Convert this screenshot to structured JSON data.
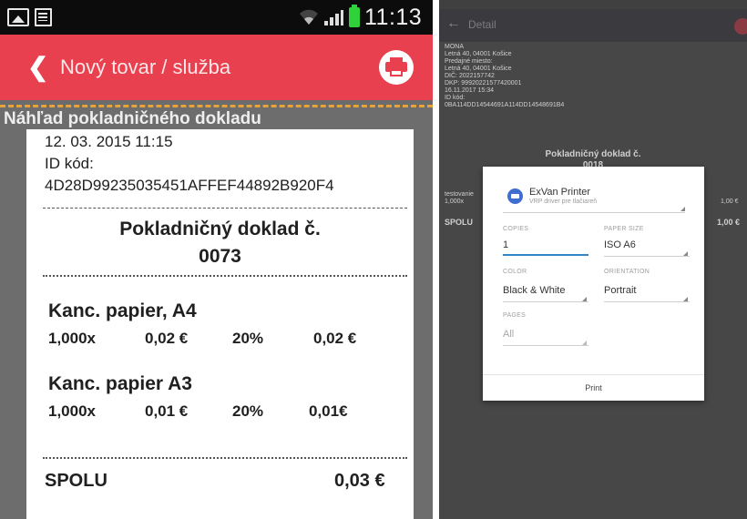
{
  "left": {
    "status": {
      "time": "11:13"
    },
    "appbar": {
      "back": "❮",
      "title": "Nový tovar / služba"
    },
    "preview_title": "Náhľad pokladničného dokladu",
    "receipt": {
      "datetime": "12. 03. 2015 11:15",
      "id_label": "ID kód:",
      "id_code": "4D28D99235035451AFFEF44892B920F4",
      "doc_line1": "Pokladničný doklad č.",
      "doc_line2": "0073",
      "items": [
        {
          "name": "Kanc. papier, A4",
          "qty": "1,000x",
          "price": "0,02 €",
          "vat": "20%",
          "total": "0,02 €"
        },
        {
          "name": "Kanc. papier A3",
          "qty": "1,000x",
          "price": "0,01 €",
          "vat": "20%",
          "total": "0,01€"
        }
      ],
      "total_label": "SPOLU",
      "total_value": "0,03 €"
    }
  },
  "right": {
    "appbar": {
      "back": "←",
      "title": "Detail"
    },
    "receipt_lines": [
      "MONA",
      "Letná 40, 04001 Košice",
      "Predajné miesto:",
      "Letná 40, 04001 Košice",
      "DIČ: 2022157742",
      "DKP: 99920221577420001",
      "16.11.2017 15:34",
      "ID kód:",
      "0BA114DD14544691A114DD14548691B4"
    ],
    "doc_line1": "Pokladničný doklad č.",
    "doc_line2": "0018",
    "item_name": "testovanie",
    "item_qty": "1,000x",
    "item_total": "1,00 €",
    "total_label": "SPOLU",
    "total_value": "1,00 €",
    "dialog": {
      "printer_name": "ExVan Printer",
      "printer_sub": "VRP driver pre tlačiareň",
      "copies_label": "COPIES",
      "copies_value": "1",
      "paper_label": "PAPER SIZE",
      "paper_value": "ISO A6",
      "color_label": "COLOR",
      "color_value": "Black & White",
      "orientation_label": "ORIENTATION",
      "orientation_value": "Portrait",
      "pages_label": "PAGES",
      "pages_value": "All",
      "print_label": "Print"
    }
  }
}
